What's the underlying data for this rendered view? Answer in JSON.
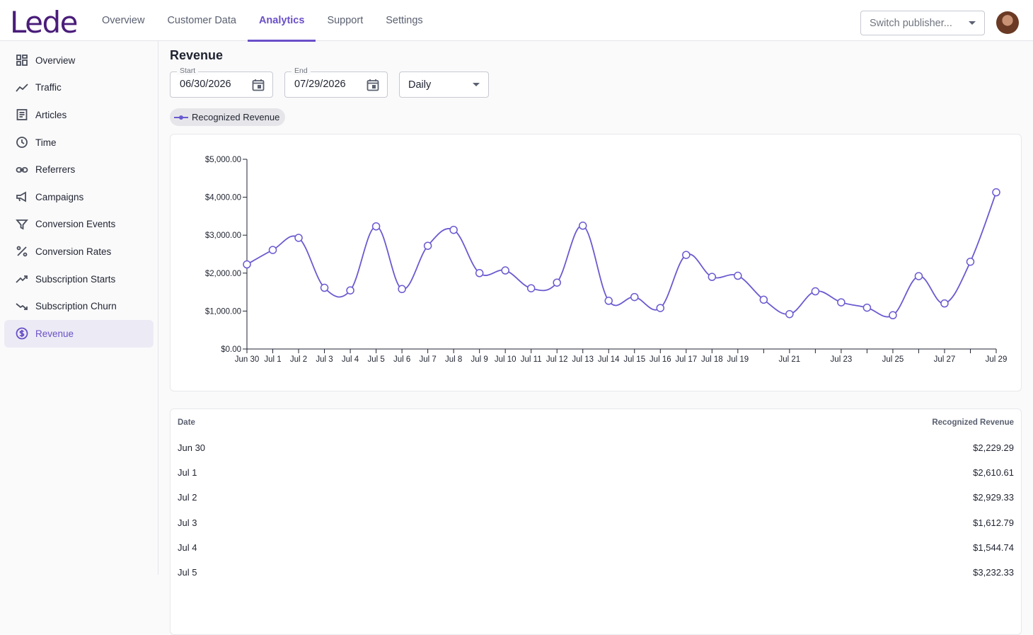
{
  "app": {
    "logo": "Lede"
  },
  "topnav": {
    "tabs": [
      {
        "label": "Overview",
        "active": false
      },
      {
        "label": "Customer Data",
        "active": false
      },
      {
        "label": "Analytics",
        "active": true
      },
      {
        "label": "Support",
        "active": false
      },
      {
        "label": "Settings",
        "active": false
      }
    ],
    "publisher_placeholder": "Switch publisher..."
  },
  "sidebar": {
    "items": [
      {
        "label": "Overview",
        "icon": "dashboard-icon"
      },
      {
        "label": "Traffic",
        "icon": "trend-line-icon"
      },
      {
        "label": "Articles",
        "icon": "article-icon"
      },
      {
        "label": "Time",
        "icon": "clock-icon"
      },
      {
        "label": "Referrers",
        "icon": "link-icon"
      },
      {
        "label": "Campaigns",
        "icon": "megaphone-icon"
      },
      {
        "label": "Conversion Events",
        "icon": "filter-icon"
      },
      {
        "label": "Conversion Rates",
        "icon": "percent-icon"
      },
      {
        "label": "Subscription Starts",
        "icon": "trending-up-icon"
      },
      {
        "label": "Subscription Churn",
        "icon": "trending-down-icon"
      },
      {
        "label": "Revenue",
        "icon": "dollar-circle-icon",
        "active": true
      }
    ]
  },
  "page": {
    "title": "Revenue",
    "start_label": "Start",
    "start_value": "06/30/2026",
    "end_label": "End",
    "end_value": "07/29/2026",
    "interval": "Daily",
    "legend_chip": "Recognized Revenue"
  },
  "colors": {
    "accent": "#6a4fc8",
    "series": "#6a5ad0"
  },
  "chart_data": {
    "type": "line",
    "series": [
      {
        "name": "Recognized Revenue",
        "values": [
          2229.29,
          2610.61,
          2929.33,
          1612.79,
          1544.74,
          3232.33,
          1580,
          2720,
          3140,
          2000,
          2070,
          1600,
          1750,
          3250,
          1270,
          1370,
          1080,
          2480,
          1900,
          1930,
          1300,
          920,
          1520,
          1230,
          1090,
          890,
          1920,
          1200,
          2300,
          4130
        ]
      }
    ],
    "x": [
      "Jun 30",
      "Jul 1",
      "Jul 2",
      "Jul 3",
      "Jul 4",
      "Jul 5",
      "Jul 6",
      "Jul 7",
      "Jul 8",
      "Jul 9",
      "Jul 10",
      "Jul 11",
      "Jul 12",
      "Jul 13",
      "Jul 14",
      "Jul 15",
      "Jul 16",
      "Jul 17",
      "Jul 18",
      "Jul 19",
      "",
      "Jul 21",
      "",
      "Jul 23",
      "",
      "Jul 25",
      "",
      "Jul 27",
      "",
      "Jul 29"
    ],
    "y_ticks": [
      "$0.00",
      "$1,000.00",
      "$2,000.00",
      "$3,000.00",
      "$4,000.00",
      "$5,000.00"
    ],
    "ylim": [
      0,
      5000
    ],
    "grid": false
  },
  "table": {
    "headers": {
      "date": "Date",
      "revenue": "Recognized Revenue"
    },
    "rows": [
      {
        "date": "Jun 30",
        "revenue": "$2,229.29"
      },
      {
        "date": "Jul 1",
        "revenue": "$2,610.61"
      },
      {
        "date": "Jul 2",
        "revenue": "$2,929.33"
      },
      {
        "date": "Jul 3",
        "revenue": "$1,612.79"
      },
      {
        "date": "Jul 4",
        "revenue": "$1,544.74"
      },
      {
        "date": "Jul 5",
        "revenue": "$3,232.33"
      }
    ]
  }
}
